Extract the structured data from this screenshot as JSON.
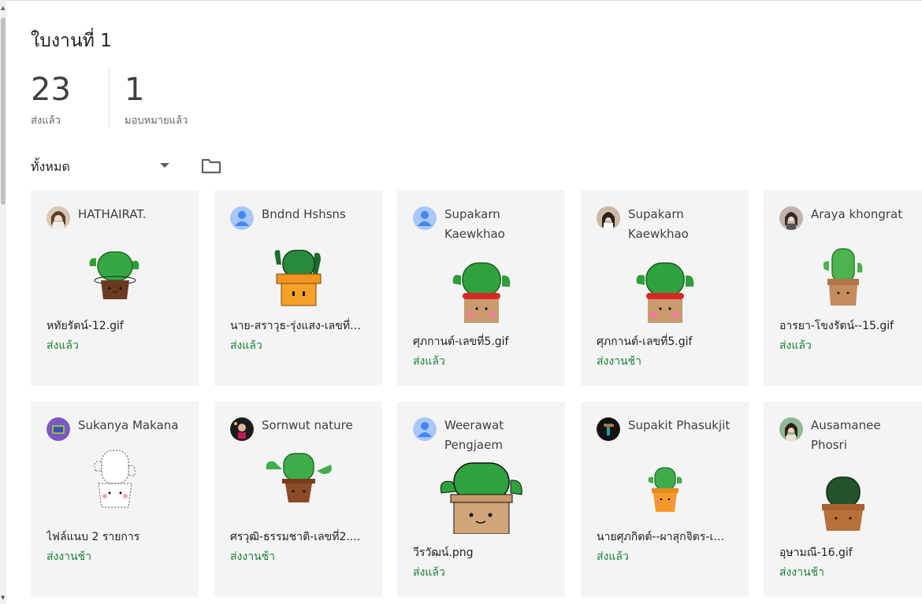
{
  "assignment": {
    "title": "ใบงานที่ 1"
  },
  "stats": [
    {
      "num": "23",
      "label": "ส่งแล้ว"
    },
    {
      "num": "1",
      "label": "มอบหมายแล้ว"
    }
  ],
  "filter": {
    "selected": "ทั้งหมด"
  },
  "icons": {
    "folder": "folder-icon",
    "dropdown": "arrow-drop-down-icon"
  },
  "colors": {
    "status_green": "#188038",
    "card_bg": "#f4f4f4",
    "default_avatar": "#a8c7fa"
  },
  "cards": [
    {
      "name": "HATHAIRAT.",
      "file": "หทัยรัตน์-12.gif",
      "status": "ส่งแล้ว"
    },
    {
      "name": "Bndnd Hshsns",
      "file": "นาย-สราวุธ-รุ่งแสง-เลขที่…",
      "status": "ส่งแล้ว"
    },
    {
      "name": "Supakarn Kaewkhao",
      "file": "ศุภกานต์-เลขที่5.gif",
      "status": "ส่งแล้ว"
    },
    {
      "name": "Supakarn Kaewkhao",
      "file": "ศุภกานต์-เลขที่5.gif",
      "status": "ส่งงานช้า"
    },
    {
      "name": "Araya khongrat",
      "file": "อารยา-โขงรัตน์--15.gif",
      "status": "ส่งแล้ว"
    },
    {
      "name": "Sukanya Makana",
      "file": "ไฟล์แนบ 2 รายการ",
      "status": "ส่งงานช้า"
    },
    {
      "name": "Sornwut nature",
      "file": "ศรวุฒิ-ธรรมชาติ-เลขที่2....",
      "status": "ส่งงานช้า"
    },
    {
      "name": "Weerawat Pengjaem",
      "file": "วีรวัฒน์.png",
      "status": "ส่งแล้ว"
    },
    {
      "name": "Supakit Phasukjit",
      "file": "นายศุภกิตต์--ผาสุกจิตร-เ…",
      "status": "ส่งแล้ว"
    },
    {
      "name": "Ausamanee Phosri",
      "file": "อุษามณี-16.gif",
      "status": "ส่งงานช้า"
    }
  ]
}
